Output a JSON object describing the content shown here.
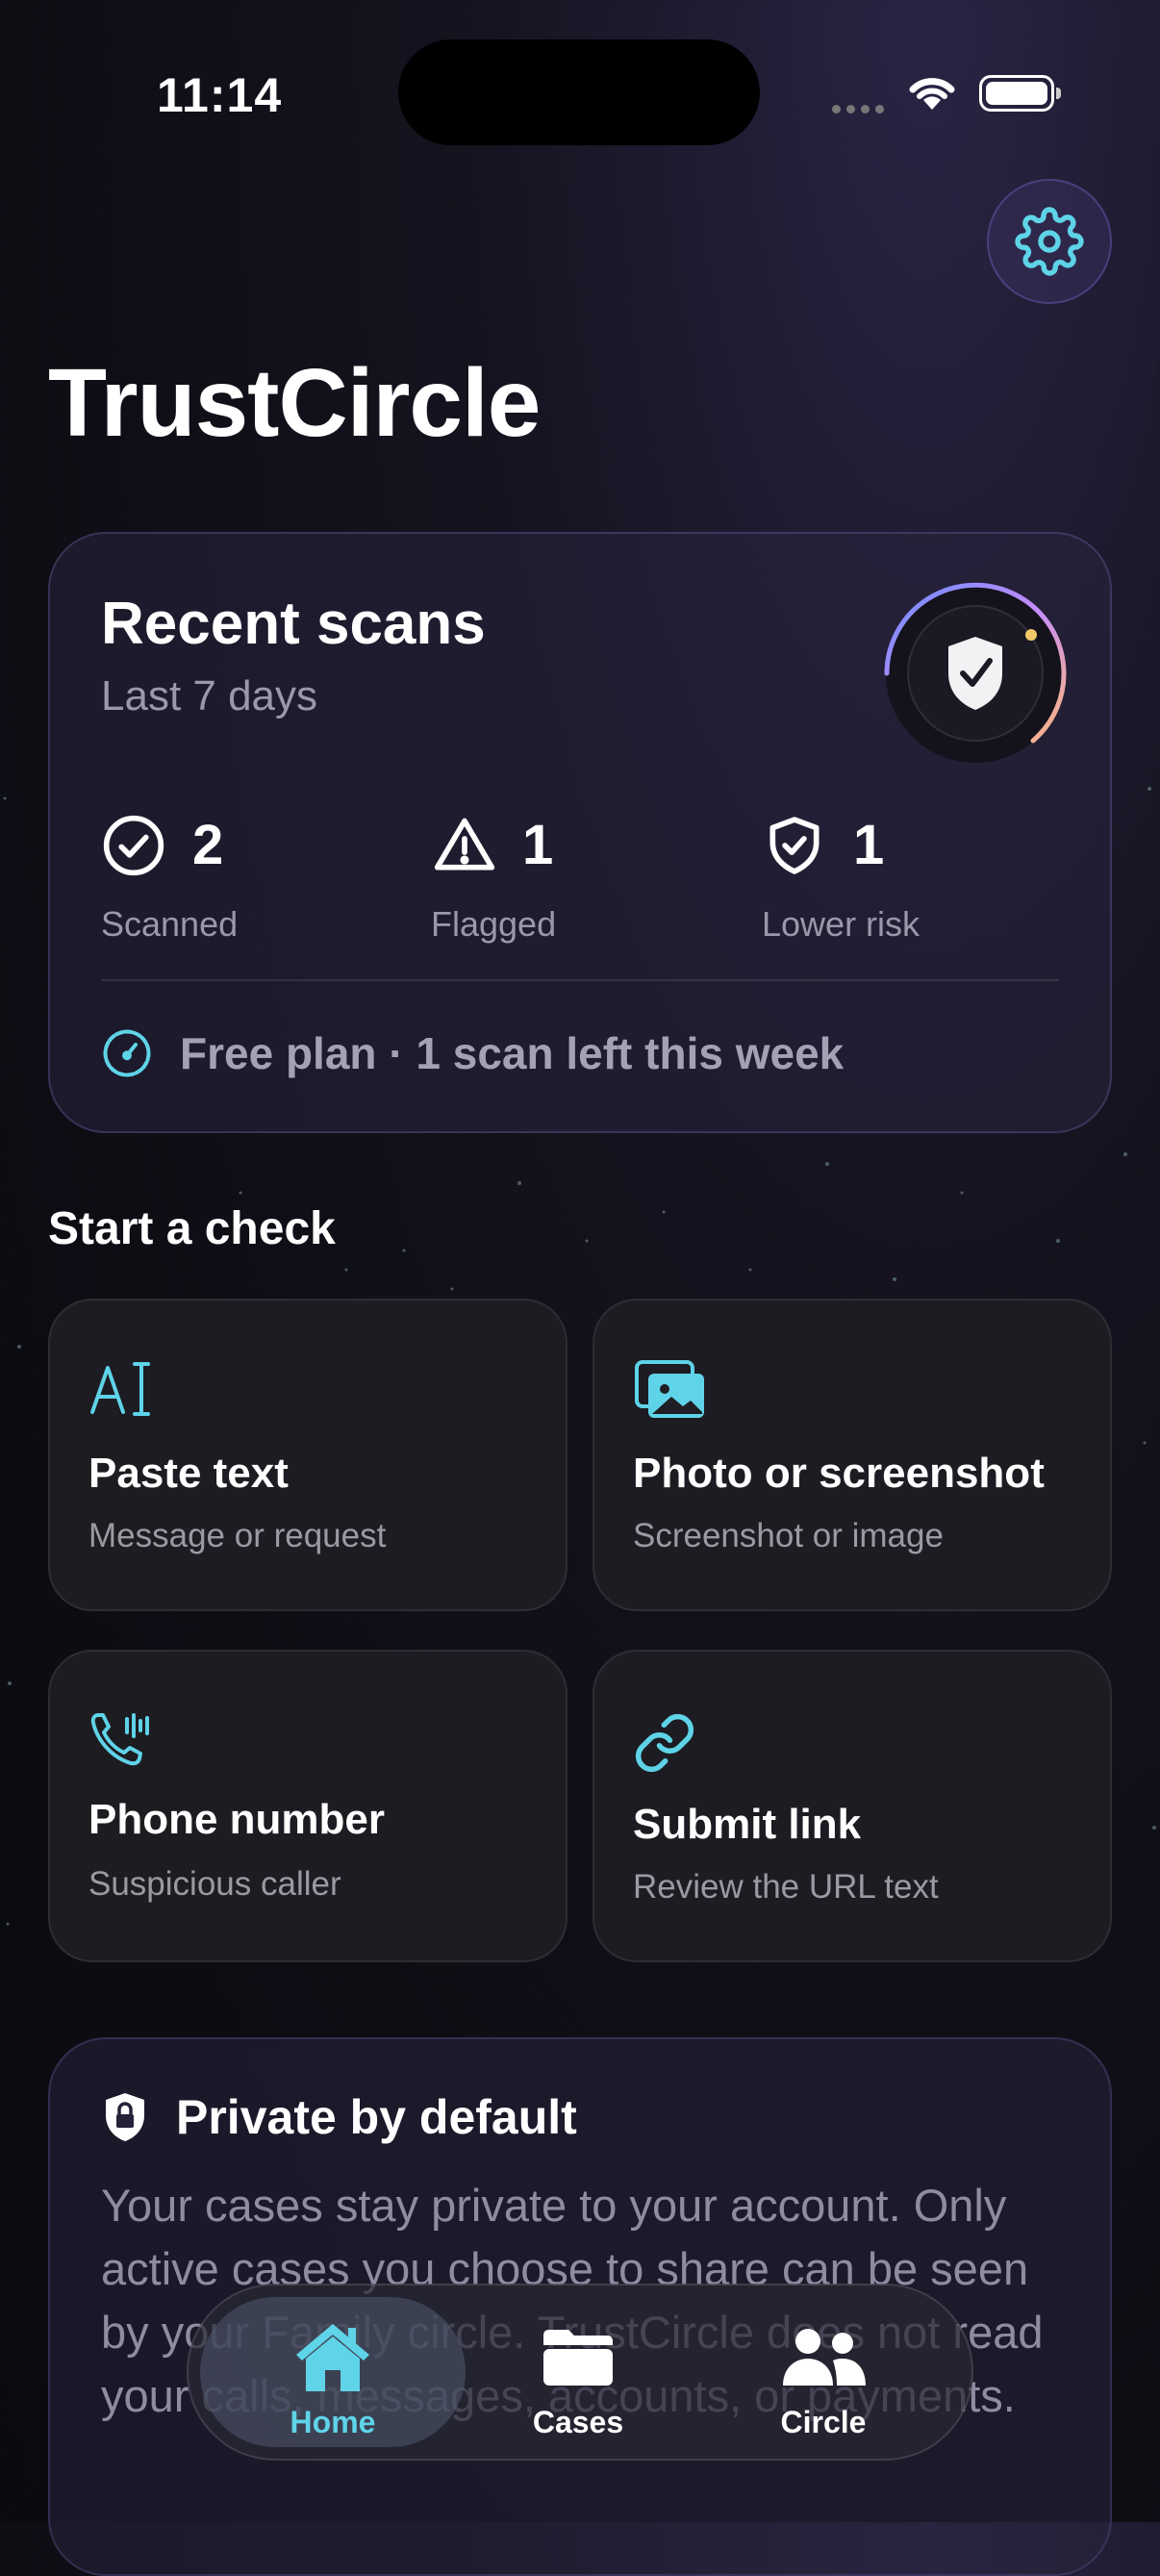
{
  "status_bar": {
    "time": "11:14"
  },
  "app": {
    "title": "TrustCircle",
    "settings_icon": "gear-icon"
  },
  "recent_scans": {
    "title": "Recent scans",
    "subtitle": "Last 7 days",
    "stats": [
      {
        "value": "2",
        "label": "Scanned",
        "icon": "check-circle-icon"
      },
      {
        "value": "1",
        "label": "Flagged",
        "icon": "warning-triangle-icon"
      },
      {
        "value": "1",
        "label": "Lower risk",
        "icon": "shield-check-icon"
      }
    ],
    "plan_text": "Free plan · 1 scan left this week"
  },
  "start_check": {
    "heading": "Start a check",
    "tiles": [
      {
        "title": "Paste text",
        "subtitle": "Message or request",
        "icon": "text-cursor-icon"
      },
      {
        "title": "Photo or screenshot",
        "subtitle": "Screenshot or image",
        "icon": "photos-icon"
      },
      {
        "title": "Phone number",
        "subtitle": "Suspicious caller",
        "icon": "phone-waves-icon"
      },
      {
        "title": "Submit link",
        "subtitle": "Review the URL text",
        "icon": "link-icon"
      }
    ]
  },
  "privacy": {
    "title": "Private by default",
    "body": "Your cases stay private to your account. Only active cases you choose to share can be seen by your Family circle. TrustCircle does not read your calls, messages, accounts, or payments."
  },
  "tab_bar": {
    "tabs": [
      {
        "label": "Home",
        "icon": "house-icon",
        "active": true
      },
      {
        "label": "Cases",
        "icon": "folder-icon",
        "active": false
      },
      {
        "label": "Circle",
        "icon": "people-icon",
        "active": false
      }
    ]
  },
  "colors": {
    "accent": "#5fd3e8",
    "background": "#0d0d14"
  }
}
